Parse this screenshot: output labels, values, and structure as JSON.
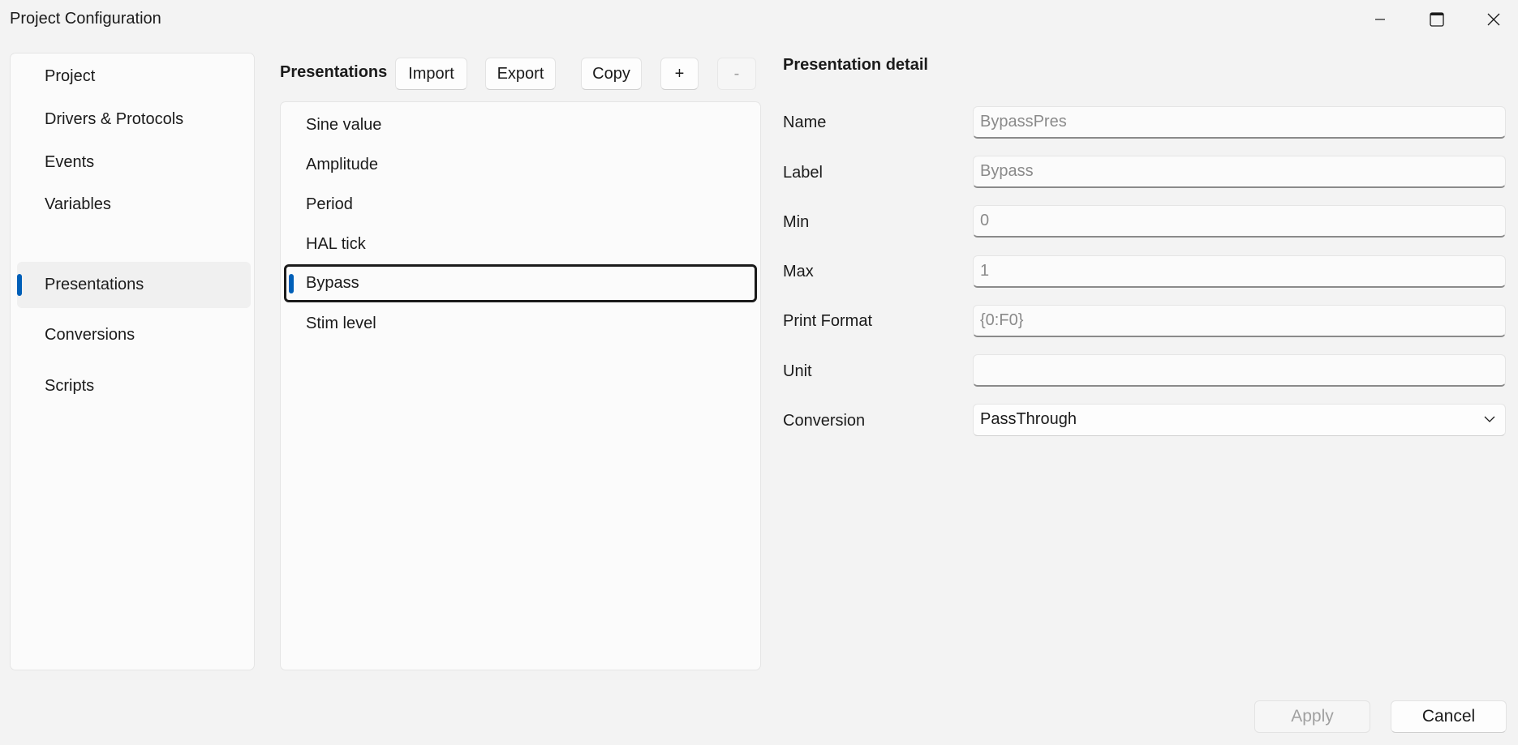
{
  "window": {
    "title": "Project Configuration"
  },
  "nav": {
    "items": [
      {
        "label": "Project"
      },
      {
        "label": "Drivers & Protocols"
      },
      {
        "label": "Events"
      },
      {
        "label": "Variables"
      },
      {
        "label": "Presentations",
        "selected": true
      },
      {
        "label": "Conversions"
      },
      {
        "label": "Scripts"
      }
    ]
  },
  "toolbar": {
    "title": "Presentations",
    "import_label": "Import",
    "export_label": "Export",
    "copy_label": "Copy",
    "add_label": "+",
    "remove_label": "-"
  },
  "list": {
    "items": [
      {
        "label": "Sine value"
      },
      {
        "label": "Amplitude"
      },
      {
        "label": "Period"
      },
      {
        "label": "HAL tick"
      },
      {
        "label": "Bypass",
        "selected": true
      },
      {
        "label": "Stim level"
      }
    ]
  },
  "detail": {
    "title": "Presentation detail",
    "name_label": "Name",
    "name_value": "BypassPres",
    "label_label": "Label",
    "label_value": "Bypass",
    "min_label": "Min",
    "min_value": "0",
    "max_label": "Max",
    "max_value": "1",
    "format_label": "Print Format",
    "format_value": "{0:F0}",
    "unit_label": "Unit",
    "unit_value": "",
    "conversion_label": "Conversion",
    "conversion_value": "PassThrough"
  },
  "footer": {
    "apply_label": "Apply",
    "cancel_label": "Cancel"
  },
  "colors": {
    "accent": "#005fb8",
    "background": "#f3f3f3",
    "panel": "#fbfbfb"
  }
}
